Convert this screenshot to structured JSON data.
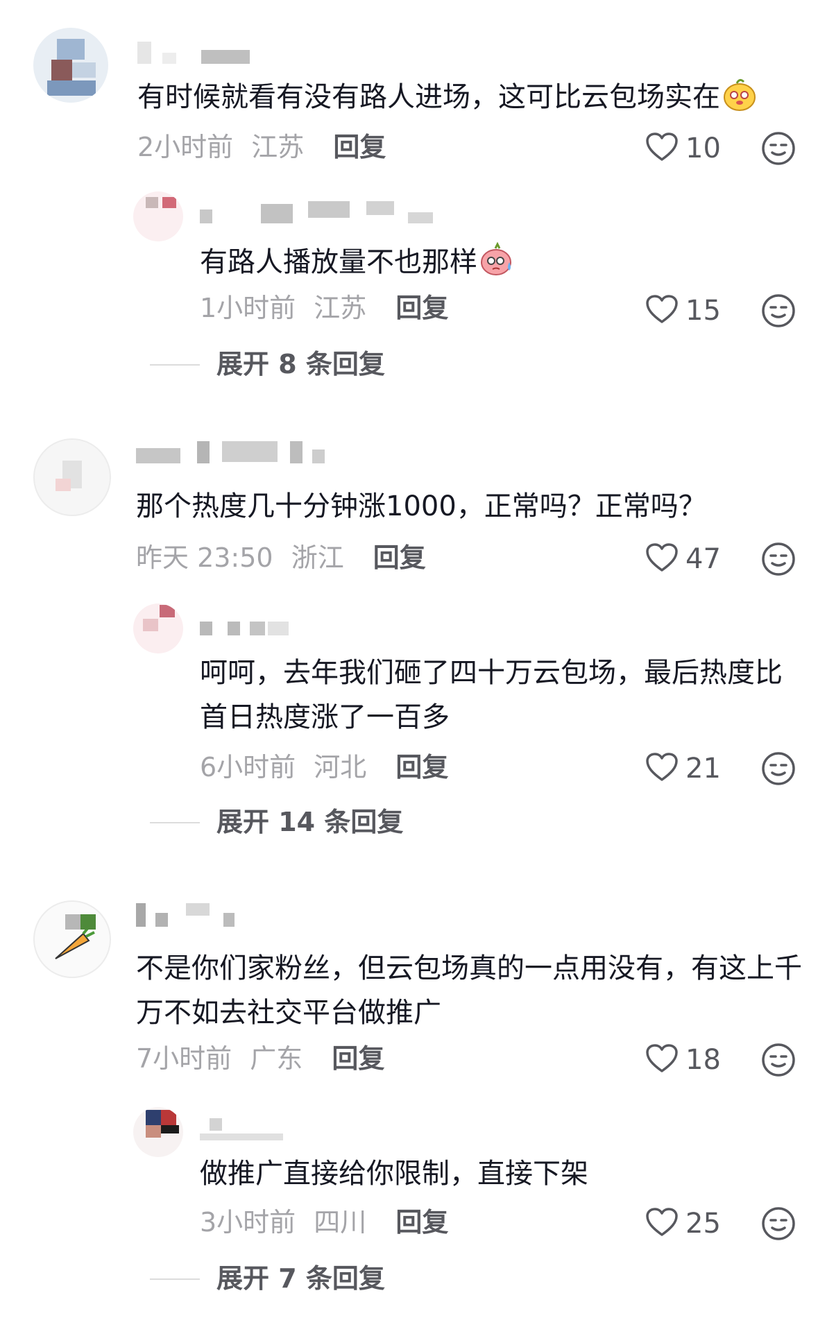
{
  "comments": [
    {
      "text": "有时候就看有没有路人进场，这可比云包场实在",
      "time": "2小时前",
      "location": "江苏",
      "reply_label": "回复",
      "likes": "10",
      "emoji": "smiling-face-emoji",
      "reply": {
        "text": "有路人播放量不也那样",
        "time": "1小时前",
        "location": "江苏",
        "reply_label": "回复",
        "likes": "15",
        "emoji": "sweating-face-emoji"
      },
      "expand_label": "展开 8 条回复"
    },
    {
      "text": "那个热度几十分钟涨1000，正常吗？正常吗？",
      "time": "昨天 23:50",
      "location": "浙江",
      "reply_label": "回复",
      "likes": "47",
      "reply": {
        "text": "呵呵，去年我们砸了四十万云包场，最后热度比首日热度涨了一百多",
        "time": "6小时前",
        "location": "河北",
        "reply_label": "回复",
        "likes": "21"
      },
      "expand_label": "展开 14 条回复"
    },
    {
      "text": "不是你们家粉丝，但云包场真的一点用没有，有这上千万不如去社交平台做推广",
      "time": "7小时前",
      "location": "广东",
      "reply_label": "回复",
      "likes": "18",
      "reply": {
        "text": "做推广直接给你限制，直接下架",
        "time": "3小时前",
        "location": "四川",
        "reply_label": "回复",
        "likes": "25"
      },
      "expand_label": "展开 7 条回复"
    }
  ],
  "icons": {
    "like": "heart-icon",
    "dislike": "neutral-face-icon"
  },
  "colors": {
    "text": "#161823",
    "meta": "#a4a4a8",
    "action": "#57585e"
  }
}
